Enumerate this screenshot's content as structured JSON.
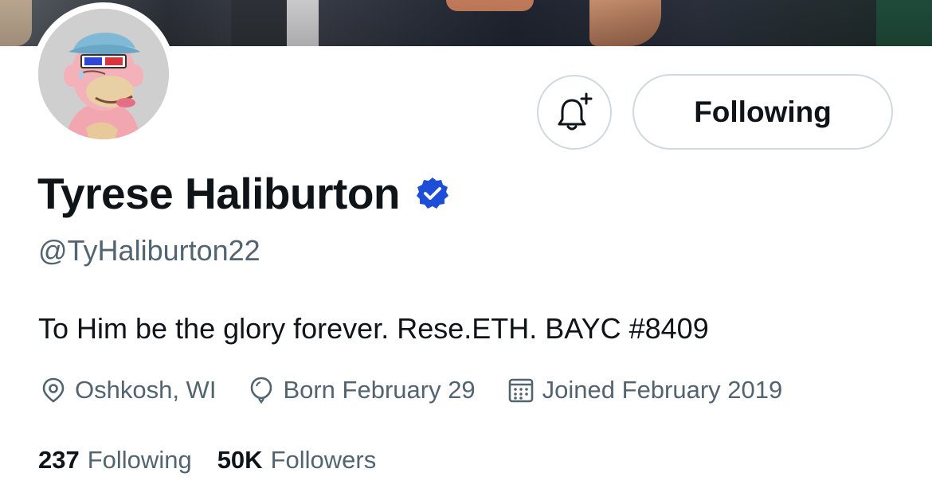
{
  "profile": {
    "display_name": "Tyrese Haliburton",
    "handle": "@TyHaliburton22",
    "bio": "To Him be the glory forever. Rese.ETH. BAYC #8409",
    "location": "Oshkosh, WI",
    "birthday": "Born February 29",
    "joined": "Joined February 2019",
    "verified": true
  },
  "actions": {
    "notify_icon": "bell-plus-icon",
    "follow_label": "Following"
  },
  "stats": {
    "following_count": "237",
    "following_label": "Following",
    "followers_count": "50K",
    "followers_label": "Followers"
  },
  "icons": {
    "location": "location-pin-icon",
    "birthday": "balloon-icon",
    "joined": "calendar-icon",
    "verified": "verified-badge-icon"
  },
  "colors": {
    "text_primary": "#0f1419",
    "text_secondary": "#536471",
    "border": "#cfd9de",
    "verified": "#1d4ed8"
  }
}
